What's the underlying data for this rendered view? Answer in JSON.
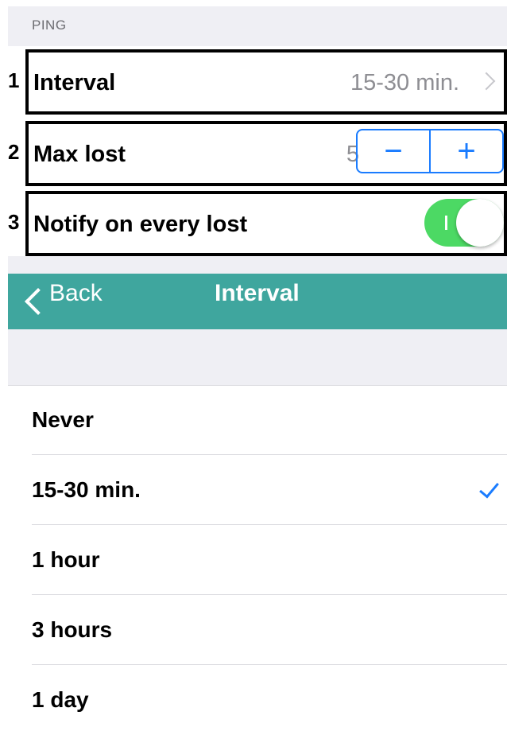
{
  "settings": {
    "section_header": "PING",
    "rows": [
      {
        "callout": "1",
        "label": "Interval",
        "value": "15-30 min."
      },
      {
        "callout": "2",
        "label": "Max lost",
        "value": "5"
      },
      {
        "callout": "3",
        "label": "Notify on every lost"
      }
    ],
    "stepper": {
      "minus": "−",
      "plus": "+"
    },
    "toggle": {
      "on": true,
      "on_mark": "I"
    }
  },
  "navbar": {
    "back_label": "Back",
    "title": "Interval",
    "background": "#3fa69e"
  },
  "interval_options": {
    "selected_index": 1,
    "items": [
      "Never",
      "15-30 min.",
      "1 hour",
      "3 hours",
      "1 day"
    ]
  },
  "colors": {
    "accent": "#1a7cff",
    "toggle_on": "#4cd964",
    "navbar": "#3fa69e"
  },
  "icons": [
    "chevron-right-icon",
    "chevron-left-icon",
    "checkmark-icon"
  ]
}
